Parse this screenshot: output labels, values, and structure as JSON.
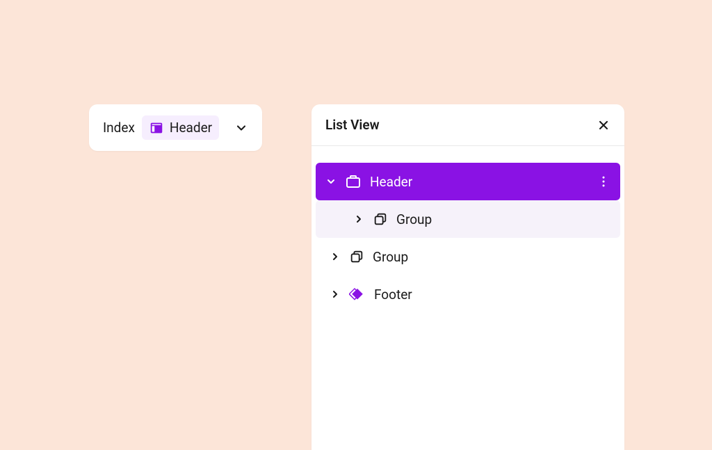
{
  "breadcrumb": {
    "root_label": "Index",
    "chip_label": "Header"
  },
  "panel": {
    "title": "List View"
  },
  "tree": {
    "item0": {
      "label": "Header"
    },
    "item1": {
      "label": "Group"
    },
    "item2": {
      "label": "Group"
    },
    "item3": {
      "label": "Footer"
    }
  },
  "colors": {
    "accent": "#8A12E4",
    "background": "#FCE5D8"
  }
}
